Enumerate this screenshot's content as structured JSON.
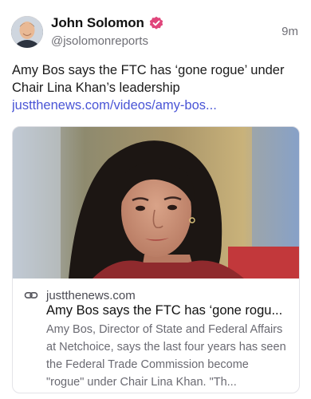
{
  "post": {
    "author_name": "John Solomon",
    "handle": "@jsolomonreports",
    "time": "9m",
    "text": "Amy Bos says the FTC has ‘gone rogue’ under Chair Lina Khan’s leadership",
    "link": "justthenews.com/videos/amy-bos...",
    "verified_icon": "verified-badge-icon",
    "accent_color": "#4a55d6",
    "badge_color": "#e0457b"
  },
  "card": {
    "domain": "justthenews.com",
    "title": "Amy Bos says the FTC has ‘gone rogu...",
    "description": "Amy Bos, Director of State and Federal Affairs at Netchoice, says the last four years has seen the Federal Trade Commission become \"rogue\" under Chair Lina Khan. \"Th...",
    "link_icon": "link-icon"
  }
}
